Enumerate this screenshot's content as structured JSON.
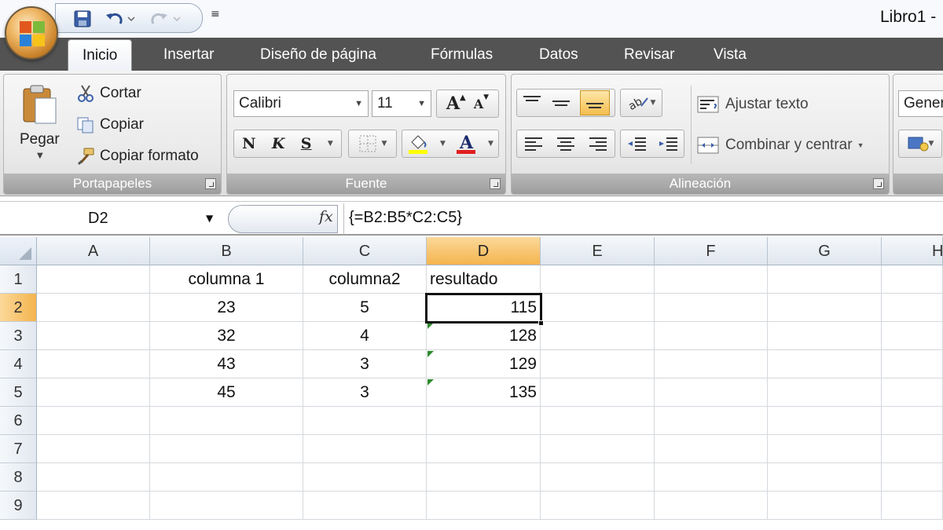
{
  "window": {
    "title": "Libro1 -"
  },
  "quick_access": {
    "items": [
      {
        "name": "save-icon"
      },
      {
        "name": "undo-icon"
      },
      {
        "name": "redo-icon"
      }
    ],
    "customize_glyph": "≡"
  },
  "tabs": [
    {
      "label": "Inicio",
      "active": true
    },
    {
      "label": "Insertar"
    },
    {
      "label": "Diseño de página"
    },
    {
      "label": "Fórmulas"
    },
    {
      "label": "Datos"
    },
    {
      "label": "Revisar"
    },
    {
      "label": "Vista"
    }
  ],
  "ribbon": {
    "clipboard": {
      "label": "Portapapeles",
      "paste": "Pegar",
      "cut": "Cortar",
      "copy": "Copiar",
      "format_painter": "Copiar formato"
    },
    "font": {
      "label": "Fuente",
      "font_name": "Calibri",
      "font_size": "11",
      "bold": "N",
      "italic": "K",
      "underline": "S",
      "grow": "A",
      "shrink": "A"
    },
    "alignment": {
      "label": "Alineación",
      "wrap_text": "Ajustar texto",
      "merge_center": "Combinar y centrar"
    },
    "number": {
      "format": "Gener"
    }
  },
  "formula_bar": {
    "name_box": "D2",
    "fx": "fx",
    "formula": "{=B2:B5*C2:C5}"
  },
  "sheet": {
    "columns": [
      "A",
      "B",
      "C",
      "D",
      "E",
      "F",
      "G",
      "H"
    ],
    "selected_column": "D",
    "rows": [
      "1",
      "2",
      "3",
      "4",
      "5",
      "6",
      "7",
      "8",
      "9"
    ],
    "selected_row": "2",
    "cells": {
      "B1": "columna 1",
      "C1": "columna2",
      "D1": "resultado",
      "B2": "23",
      "C2": "5",
      "D2": "115",
      "B3": "32",
      "C3": "4",
      "D3": "128",
      "B4": "43",
      "C4": "3",
      "D4": "129",
      "B5": "45",
      "C5": "3",
      "D5": "135"
    },
    "active_cell": "D2"
  }
}
